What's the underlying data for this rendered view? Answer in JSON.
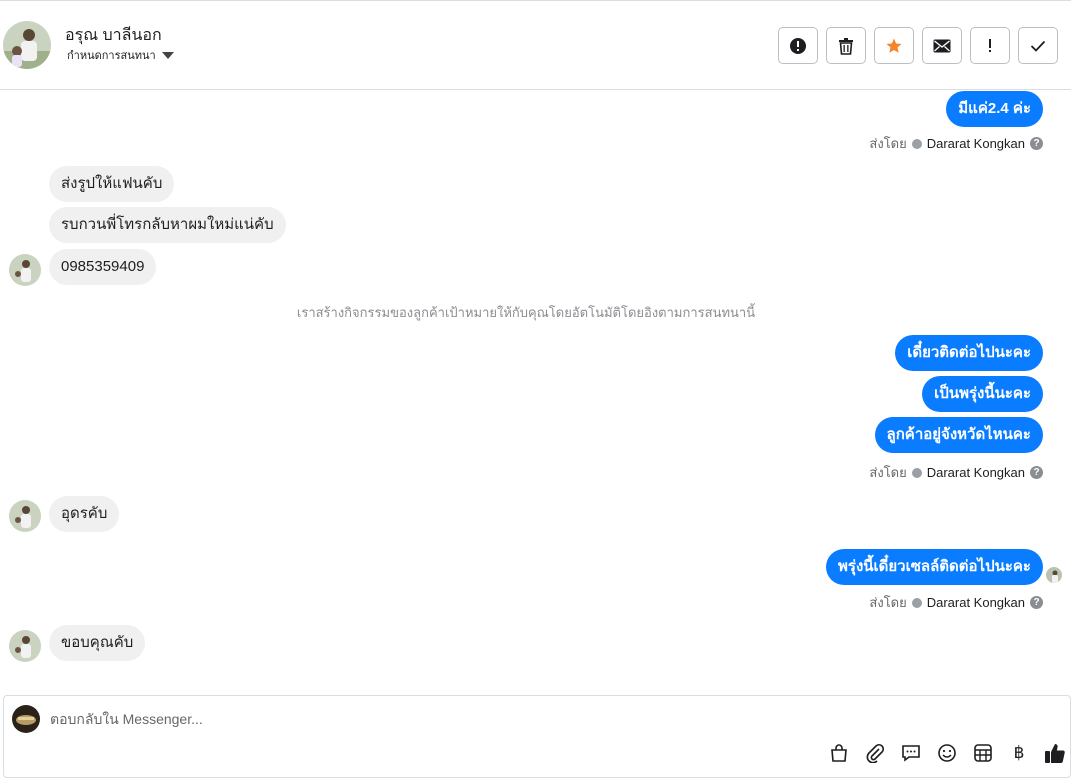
{
  "header": {
    "contact_name": "อรุณ บาลีนอก",
    "assign_label": "กำหนดการสนทนา"
  },
  "actions": [
    {
      "name": "spam-button",
      "icon": "alert-circle-icon"
    },
    {
      "name": "delete-button",
      "icon": "trash-icon"
    },
    {
      "name": "star-button",
      "icon": "star-icon"
    },
    {
      "name": "mark-unread-button",
      "icon": "envelope-icon"
    },
    {
      "name": "follow-up-button",
      "icon": "exclamation-icon"
    },
    {
      "name": "mark-done-button",
      "icon": "check-icon"
    }
  ],
  "colors": {
    "outgoing_bubble": "#0a7cff",
    "incoming_bubble": "#f0f0f0",
    "star_accent": "#f5832a"
  },
  "messages": {
    "m1": "มีแค่2.4 ค่ะ",
    "m2": "ส่งรูปให้แฟนคับ",
    "m3": "รบกวนพี่โทรกลับหาผมใหม่แน่คับ",
    "m4": "0985359409",
    "m5": "เดี๋ยวติดต่อไปนะคะ",
    "m6": "เป็นพรุ่งนี้นะคะ",
    "m7": "ลูกค้าอยู่จังหวัดไหนคะ",
    "m8": "อุดรคับ",
    "m9": "พรุ่งนี้เดี๋ยวเซลล์ติดต่อไปนะคะ",
    "m10": "ขอบคุณคับ"
  },
  "sent_by": {
    "label": "ส่งโดย",
    "agent": "Dararat Kongkan",
    "help": "?"
  },
  "system_message": "เราสร้างกิจกรรมของลูกค้าเป้าหมายให้กับคุณโดยอัตโนมัติโดยอิงตามการสนทนานี้",
  "composer": {
    "placeholder": "ตอบกลับใน Messenger..."
  },
  "composer_tools": [
    "shopping-bag-icon",
    "paperclip-icon",
    "saved-reply-icon",
    "emoji-icon",
    "table-icon",
    "baht-icon",
    "thumbs-up-icon"
  ],
  "currency_symbol": "฿"
}
